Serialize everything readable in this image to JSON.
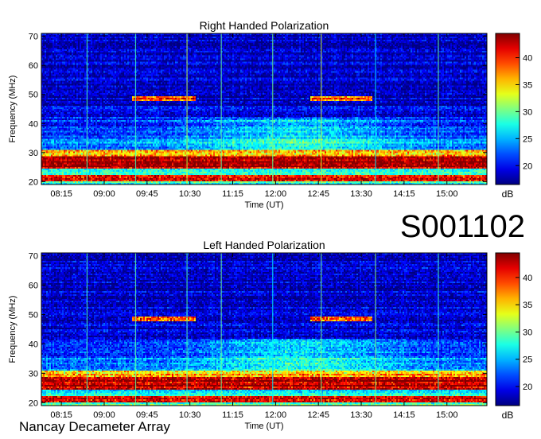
{
  "observation_id": "S001102",
  "footer_label": "Nancay Decameter Array",
  "chart_data": [
    {
      "type": "heatmap",
      "title": "Right Handed Polarization",
      "xlabel": "Time (UT)",
      "ylabel": "Frequency (MHz)",
      "x_tick_labels": [
        "08:15",
        "09:00",
        "09:45",
        "10:30",
        "11:15",
        "12:00",
        "12:45",
        "13:30",
        "14:15",
        "15:00"
      ],
      "x_range_hours": [
        7.9,
        15.7
      ],
      "ylim": [
        19,
        71
      ],
      "y_ticks": [
        20,
        30,
        40,
        50,
        60,
        70
      ],
      "colorbar": {
        "label": "dB",
        "range": [
          16.5,
          44.5
        ],
        "ticks": [
          20,
          25,
          30,
          35,
          40
        ]
      },
      "strong_bands_mhz": [
        [
          20,
          22
        ],
        [
          24.5,
          28.5
        ]
      ],
      "emission_features_mhz": [
        48.5
      ]
    },
    {
      "type": "heatmap",
      "title": "Left Handed Polarization",
      "xlabel": "Time (UT)",
      "ylabel": "Frequency (MHz)",
      "x_tick_labels": [
        "08:15",
        "09:00",
        "09:45",
        "10:30",
        "11:15",
        "12:00",
        "12:45",
        "13:30",
        "14:15",
        "15:00"
      ],
      "x_range_hours": [
        7.9,
        15.7
      ],
      "ylim": [
        19,
        71
      ],
      "y_ticks": [
        20,
        30,
        40,
        50,
        60,
        70
      ],
      "colorbar": {
        "label": "dB",
        "range": [
          16.5,
          44.5
        ],
        "ticks": [
          20,
          25,
          30,
          35,
          40
        ]
      },
      "strong_bands_mhz": [
        [
          20,
          22
        ],
        [
          24.5,
          28.5
        ]
      ],
      "emission_features_mhz": [
        48.5
      ]
    }
  ]
}
